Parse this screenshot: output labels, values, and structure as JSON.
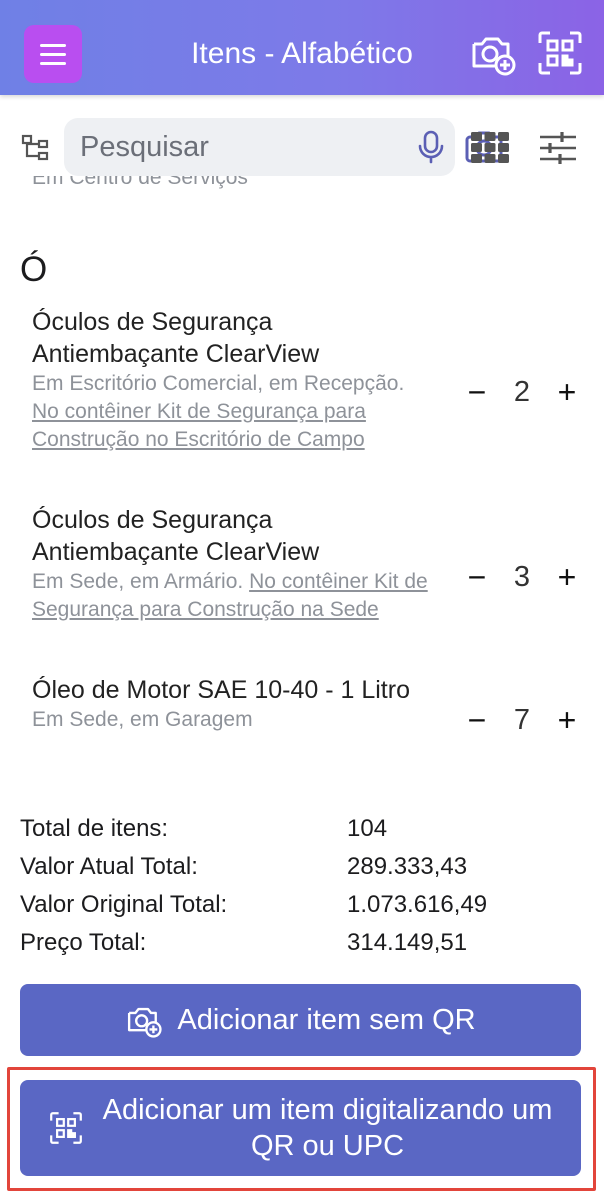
{
  "header": {
    "title": "Itens - Alfabético",
    "menu_icon": "hamburger-menu-icon",
    "accent_color": "#b94ef0"
  },
  "search": {
    "placeholder": "Pesquisar",
    "value": ""
  },
  "list": {
    "cut_off_location": "Em Centro de Serviços",
    "section_letter": "Ó",
    "items": [
      {
        "name": "Óculos de Segurança Antiembaçante ClearView",
        "location": "Em Escritório Comercial, em Recepção.",
        "container_link": "No contêiner Kit de Segurança para Construção no Escritório de Campo",
        "quantity": "2"
      },
      {
        "name": "Óculos de Segurança Antiembaçante ClearView",
        "location": "Em Sede, em Armário.",
        "container_link": "No contêiner Kit de Segurança para Construção na Sede",
        "quantity": "3"
      },
      {
        "name": "Óleo de Motor SAE 10-40 - 1 Litro",
        "location": "Em Sede, em Garagem",
        "container_link": "",
        "quantity": "7"
      }
    ],
    "decrement_symbol": "−",
    "increment_symbol": "+"
  },
  "totals": [
    {
      "label": "Total de itens:",
      "value": "104"
    },
    {
      "label": "Valor Atual Total:",
      "value": "289.333,43"
    },
    {
      "label": "Valor Original Total:",
      "value": "1.073.616,49"
    },
    {
      "label": "Preço Total:",
      "value": "314.149,51"
    }
  ],
  "actions": {
    "add_without_qr": "Adicionar item sem QR",
    "add_by_scanning": "Adicionar um item digitalizando um QR ou UPC",
    "button_color": "#5a67c4",
    "highlight_color": "#e2453b"
  }
}
